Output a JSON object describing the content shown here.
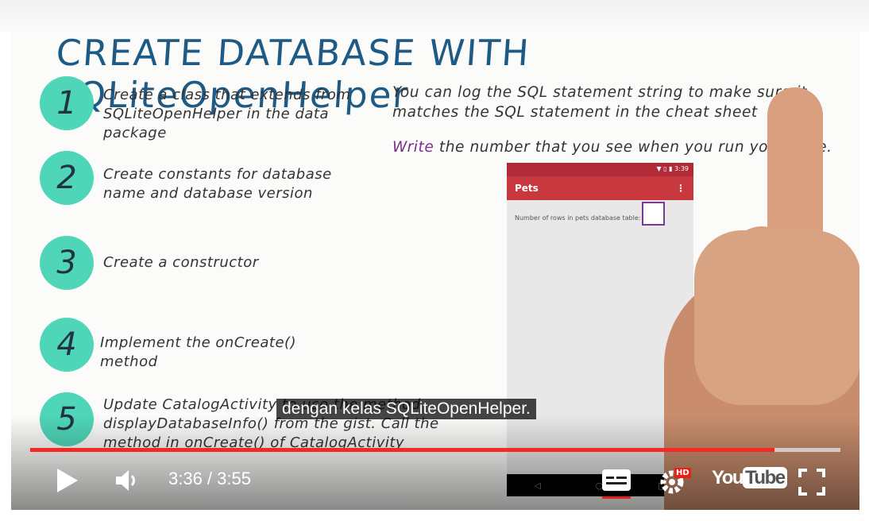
{
  "slide": {
    "title": "CREATE DATABASE WITH SQLiteOpenHelper",
    "steps": [
      {
        "num": "1",
        "text": "Create a class that extends from SQLiteOpenHelper in the data package"
      },
      {
        "num": "2",
        "text": "Create constants for database name and database version"
      },
      {
        "num": "3",
        "text": "Create a constructor"
      },
      {
        "num": "4",
        "text": "Implement the onCreate() method"
      },
      {
        "num": "5",
        "text": "Update CatalogActivity to use the method displayDatabaseInfo() from the gist. Call the method in onCreate() of CatalogActivity"
      }
    ],
    "note": "You can log the SQL statement string to make sure it matches the SQL statement in the cheat sheet",
    "write_word": "Write",
    "write_rest": " the number that you see when you run your code.",
    "accent_color": "#4fd6b8",
    "title_color": "#1d5a86"
  },
  "phone": {
    "status_time": "3:39",
    "app_title": "Pets",
    "menu_icon": "overflow-menu-icon",
    "rows_label": "Number of rows in pets database table:",
    "nav": [
      "◁",
      "○",
      "□"
    ],
    "appbar_color": "#c9373f"
  },
  "player": {
    "caption": "dengan kelas SQLiteOpenHelper.",
    "time": "3:36 / 3:55",
    "progress_percent": 91.9,
    "buffered_percent": 100,
    "hd_badge": "HD",
    "logo_you": "You",
    "logo_tube": "Tube",
    "progress_color": "#f12b24"
  }
}
